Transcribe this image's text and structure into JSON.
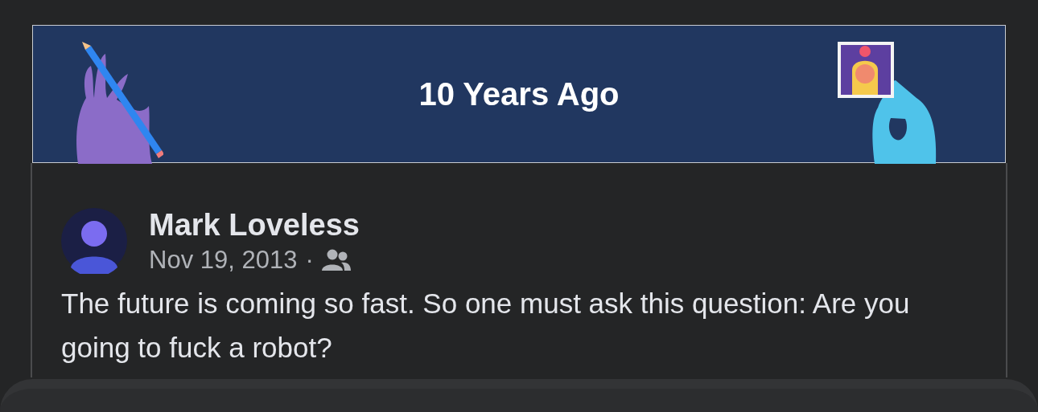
{
  "banner": {
    "title": "10 Years Ago"
  },
  "post": {
    "author": "Mark Loveless",
    "date": "Nov 19, 2013",
    "separator": "·",
    "body": "The future is coming so fast. So one must ask this question: Are you going to fuck a robot?"
  }
}
